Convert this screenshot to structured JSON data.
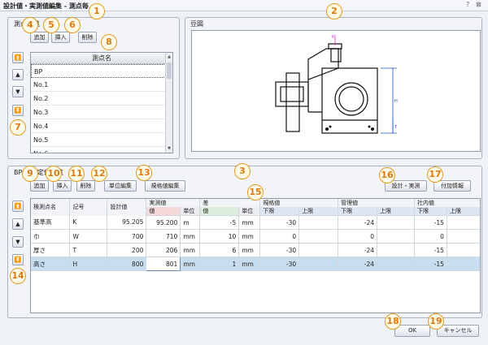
{
  "window": {
    "title": "設計値・実測値編集 - 測点毎",
    "help_icon": "?",
    "close_icon": "⊠"
  },
  "point_panel": {
    "label": "測点一覧",
    "buttons": {
      "add": "追加",
      "insert": "挿入",
      "delete": "削除"
    },
    "nav": {
      "top": "⏫",
      "up": "▲",
      "down": "▼",
      "bottom": "⏬"
    },
    "list_header": "測点名",
    "points": [
      "BP",
      "No.1",
      "No.2",
      "No.3",
      "No.4",
      "No.5",
      "No.6"
    ]
  },
  "drawing_panel": {
    "label": "豆図",
    "dims": {
      "top_letter": "K",
      "right_letter": "H",
      "right_small": "T"
    }
  },
  "measure_panel": {
    "label": "BP の測定値一覧",
    "buttons": {
      "add": "追加",
      "insert": "挿入",
      "delete": "削除",
      "unit_edit": "単位編集",
      "std_edit": "規格値編集",
      "design_actual": "設計・実測",
      "extra_info": "付加情報"
    },
    "nav": {
      "top": "⏫",
      "up": "▲",
      "down": "▼",
      "bottom": "⏬"
    },
    "headers": {
      "item": "検測点名",
      "symbol": "記号",
      "design": "設計値",
      "actual": "実測値",
      "diff": "差",
      "std": "規格値",
      "mgmt": "管理値",
      "internal": "社内値",
      "value": "値",
      "unit": "単位",
      "lower": "下限",
      "upper": "上限"
    },
    "rows": [
      {
        "item": "基準高",
        "symbol": "K",
        "design": "95.205",
        "actual": "95.200",
        "unit1": "m",
        "diff": "-5",
        "unit2": "mm",
        "std_lo": "-30",
        "std_hi": "",
        "mg_lo": "-24",
        "mg_hi": "",
        "in_lo": "-15",
        "in_hi": ""
      },
      {
        "item": "巾",
        "symbol": "W",
        "design": "700",
        "actual": "710",
        "unit1": "mm",
        "diff": "10",
        "unit2": "mm",
        "std_lo": "0",
        "std_hi": "",
        "mg_lo": "0",
        "mg_hi": "",
        "in_lo": "0",
        "in_hi": ""
      },
      {
        "item": "厚さ",
        "symbol": "T",
        "design": "200",
        "actual": "206",
        "unit1": "mm",
        "diff": "6",
        "unit2": "mm",
        "std_lo": "-30",
        "std_hi": "",
        "mg_lo": "-24",
        "mg_hi": "",
        "in_lo": "-15",
        "in_hi": ""
      },
      {
        "item": "高さ",
        "symbol": "H",
        "design": "800",
        "actual": "801",
        "unit1": "mm",
        "diff": "1",
        "unit2": "mm",
        "std_lo": "-30",
        "std_hi": "",
        "mg_lo": "-24",
        "mg_hi": "",
        "in_lo": "-15",
        "in_hi": ""
      }
    ]
  },
  "footer": {
    "ok": "OK",
    "cancel": "キャンセル"
  },
  "callouts": [
    "1",
    "2",
    "3",
    "4",
    "5",
    "6",
    "7",
    "8",
    "9",
    "10",
    "11",
    "12",
    "13",
    "14",
    "15",
    "16",
    "17",
    "18",
    "19"
  ],
  "colors": {
    "callout": "#e29a1a",
    "selected_row": "#c7def0",
    "dim_line": "#1a4fd6"
  }
}
